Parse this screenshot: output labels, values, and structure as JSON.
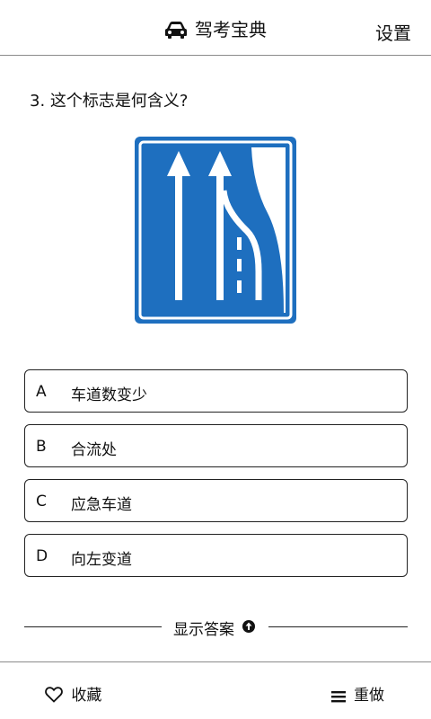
{
  "header": {
    "title": "驾考宝典",
    "settings_label": "设置",
    "title_icon": "car-icon"
  },
  "question": {
    "text": "3. 这个标志是何含义?"
  },
  "sign": {
    "image": "lane-reduction-sign",
    "background_color": "#1e6fbf",
    "marking_color": "#ffffff"
  },
  "options": [
    {
      "letter": "A",
      "text": "车道数变少"
    },
    {
      "letter": "B",
      "text": "合流处"
    },
    {
      "letter": "C",
      "text": "应急车道"
    },
    {
      "letter": "D",
      "text": "向左变道"
    }
  ],
  "reveal": {
    "label": "显示答案",
    "icon": "arrow-up-circle-icon"
  },
  "footer": {
    "favorite_label": "收藏",
    "favorite_icon": "heart-icon",
    "redo_label": "重做",
    "redo_icon": "menu-icon"
  }
}
